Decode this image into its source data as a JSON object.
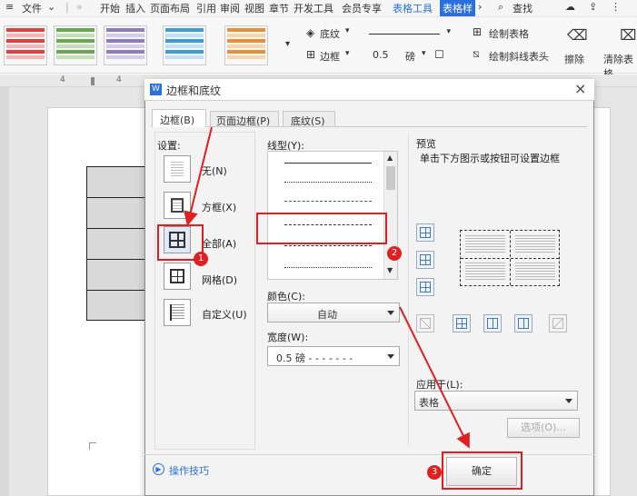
{
  "menu": {
    "file_label": "文件",
    "tabs": [
      "开始",
      "插入",
      "页面布局",
      "引用",
      "审阅",
      "视图",
      "章节",
      "开发工具",
      "会员专享"
    ],
    "table_tools": "表格工具",
    "table_style": "表格样",
    "search_label": "查找"
  },
  "ribbon": {
    "shading_label": "底纹",
    "border_label": "边框",
    "width_value": "0.5",
    "width_unit": "磅",
    "draw_table": "绘制表格",
    "draw_diagonal": "绘制斜线表头",
    "eraser": "擦除",
    "clear_style": "清除表格",
    "swatch_colors": [
      "#e04040",
      "#6aa84f",
      "#8e7cc3",
      "#3d9bd6",
      "#e69138"
    ]
  },
  "ruler": {
    "ticks": [
      "4",
      "4"
    ]
  },
  "dialog": {
    "title": "边框和底纹",
    "close_label": "×",
    "tabs": [
      "边框(B)",
      "页面边框(P)",
      "底纹(S)"
    ],
    "settings_label": "设置:",
    "settings": [
      "无(N)",
      "方框(X)",
      "全部(A)",
      "网格(D)",
      "自定义(U)"
    ],
    "line_style_label": "线型(Y):",
    "color_label": "颜色(C):",
    "color_value": "自动",
    "width_label": "宽度(W):",
    "width_value": "0.5  磅 - - - - - - -",
    "preview_label": "预览",
    "preview_hint": "单击下方图示或按钮可设置边框",
    "apply_label": "应用于(L):",
    "apply_value": "表格",
    "options_button": "选项(O)...",
    "tips_label": "操作技巧",
    "ok_button": "确定",
    "badges": [
      "1",
      "2",
      "3"
    ]
  },
  "colors": {
    "accent": "#2a6fdb",
    "annotation": "#e02020"
  }
}
